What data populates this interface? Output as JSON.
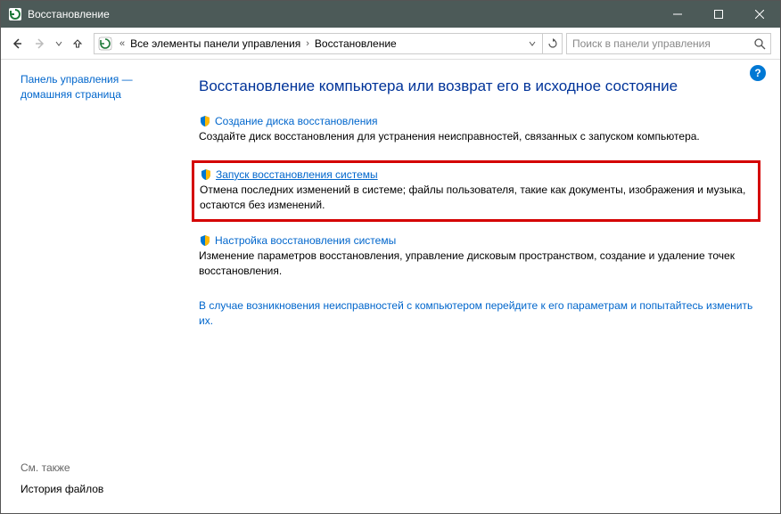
{
  "titlebar": {
    "title": "Восстановление"
  },
  "breadcrumb": {
    "part1": "Все элементы панели управления",
    "part2": "Восстановление"
  },
  "search": {
    "placeholder": "Поиск в панели управления"
  },
  "sidebar": {
    "home_line1": "Панель управления —",
    "home_line2": "домашняя страница",
    "see_also": "См. также",
    "file_history": "История файлов"
  },
  "content": {
    "heading": "Восстановление компьютера или возврат его в исходное состояние",
    "item1": {
      "link": "Создание диска восстановления",
      "desc": "Создайте диск восстановления для устранения неисправностей, связанных с запуском компьютера."
    },
    "item2": {
      "link": "Запуск восстановления системы",
      "desc": "Отмена последних изменений в системе; файлы пользователя, такие как документы, изображения и музыка, остаются без изменений."
    },
    "item3": {
      "link": "Настройка восстановления системы",
      "desc": "Изменение параметров восстановления, управление дисковым пространством, создание и удаление точек восстановления."
    },
    "footer": "В случае возникновения неисправностей с компьютером перейдите к его параметрам и попытайтесь изменить их."
  }
}
